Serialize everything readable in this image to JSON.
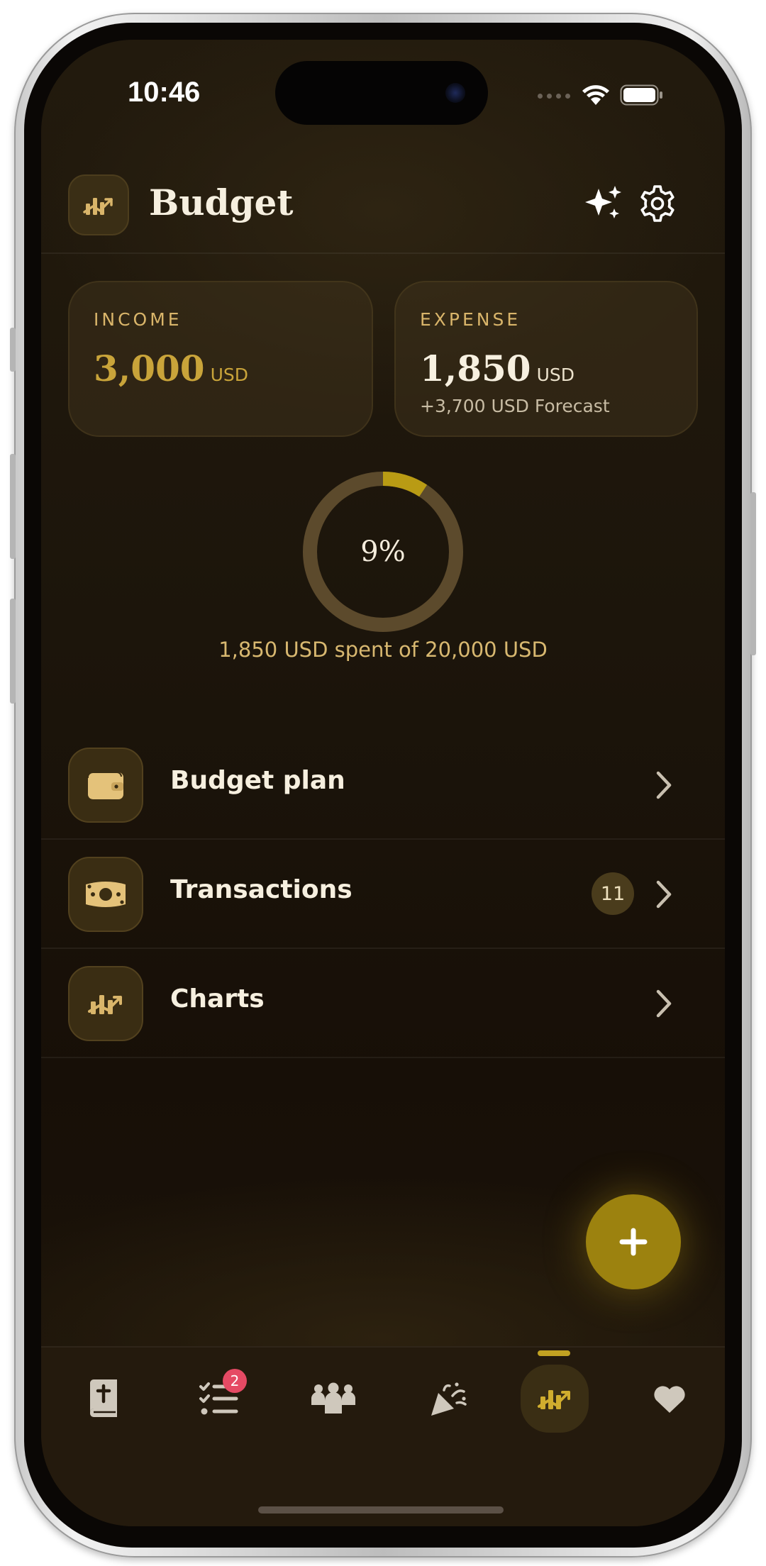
{
  "status_bar": {
    "time": "10:46"
  },
  "header": {
    "title": "Budget"
  },
  "summary": {
    "income": {
      "label": "INCOME",
      "value": "3,000",
      "unit": "USD"
    },
    "expense": {
      "label": "EXPENSE",
      "value": "1,850",
      "unit": "USD",
      "forecast": "+3,700 USD Forecast"
    }
  },
  "progress": {
    "percent_label": "9%",
    "fraction": 0.0925,
    "caption": "1,850 USD spent of 20,000 USD"
  },
  "menu": [
    {
      "label": "Budget plan",
      "icon": "wallet-icon"
    },
    {
      "label": "Transactions",
      "icon": "banknote-icon",
      "badge": "11"
    },
    {
      "label": "Charts",
      "icon": "chart-icon"
    }
  ],
  "tabbar": {
    "items": [
      {
        "name": "bible",
        "icon": "book-cross-icon"
      },
      {
        "name": "tasks",
        "icon": "checklist-icon",
        "badge": "2"
      },
      {
        "name": "people",
        "icon": "people-icon"
      },
      {
        "name": "celebrate",
        "icon": "party-popper-icon"
      },
      {
        "name": "budget",
        "icon": "chart-icon",
        "active": true
      },
      {
        "name": "favorites",
        "icon": "heart-icon"
      }
    ]
  },
  "colors": {
    "accent": "#c2a222",
    "fab": "#9c820f",
    "income_value": "#c9a43a",
    "badge_red": "#e54a64",
    "ring_track": "#5c4a2c"
  }
}
